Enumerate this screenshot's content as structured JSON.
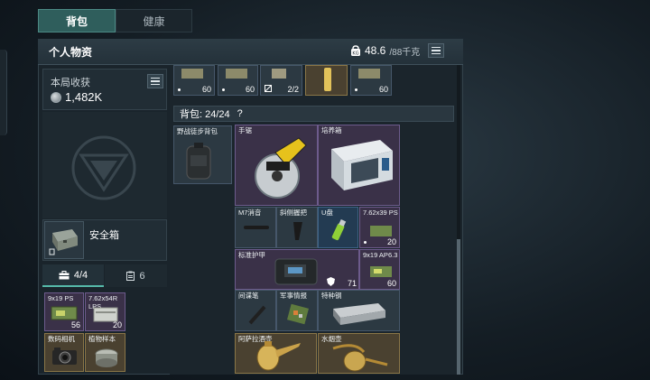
{
  "tabs": [
    {
      "label": "背包",
      "active": true
    },
    {
      "label": "健康",
      "active": false
    }
  ],
  "header": {
    "title": "个人物资",
    "weight_current": "48.6",
    "weight_max": "/88千克"
  },
  "income": {
    "title": "本局收获",
    "value": "1,482K"
  },
  "safe": {
    "label": "安全箱"
  },
  "subtabs": [
    {
      "count": "4/4",
      "icon": "briefcase-icon"
    },
    {
      "count": "6",
      "icon": "clipboard-icon"
    }
  ],
  "left_items": [
    {
      "name": "9x19 PS",
      "count": "56",
      "color": "purple"
    },
    {
      "name": "7.62x54R LPS",
      "count": "20",
      "color": "purple"
    },
    {
      "name": "数码相机",
      "count": "",
      "color": "gold"
    },
    {
      "name": "植物样本",
      "count": "",
      "color": "gold"
    }
  ],
  "top_row": [
    {
      "count": "60"
    },
    {
      "count": "60"
    },
    {
      "count": "2/2"
    },
    {
      "count": ""
    },
    {
      "count": "60"
    }
  ],
  "backpack": {
    "label": "背包: 24/24",
    "help": "?",
    "equipped_name": "野战徒步背包"
  },
  "items": [
    {
      "name": "手锯",
      "count": ""
    },
    {
      "name": "培养箱",
      "count": ""
    },
    {
      "name": "M7消音",
      "count": ""
    },
    {
      "name": "斜侧握把",
      "count": ""
    },
    {
      "name": "U盘",
      "count": ""
    },
    {
      "name": "7.62x39 PS",
      "count": "20"
    },
    {
      "name": "标准护甲",
      "count": "71"
    },
    {
      "name": "9x19 AP6.3",
      "count": "60"
    },
    {
      "name": "间谍笔",
      "count": ""
    },
    {
      "name": "军事情报",
      "count": ""
    },
    {
      "name": "特种钢",
      "count": ""
    },
    {
      "name": "阿萨拉酒壶",
      "count": ""
    },
    {
      "name": "水烟壶",
      "count": ""
    }
  ],
  "colors": {
    "accent": "#56b9a9",
    "purple_slot": "#3a3148",
    "blue_slot": "#233b52",
    "gold_slot": "#4a4130"
  }
}
